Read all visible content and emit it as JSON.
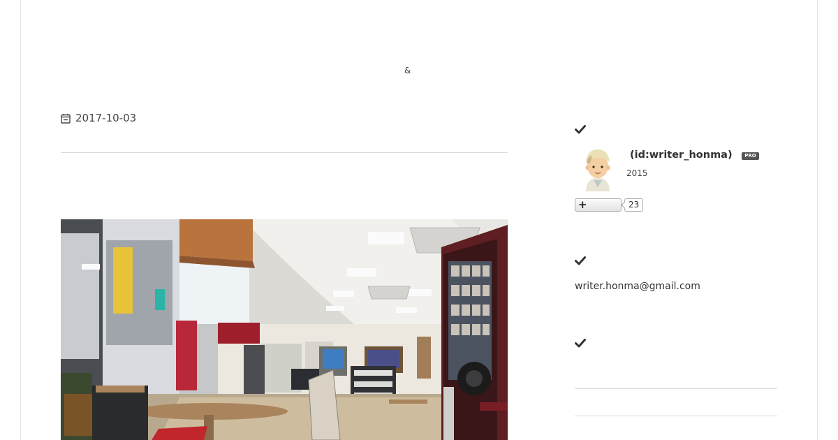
{
  "header": {
    "subtitle": "&"
  },
  "entry": {
    "date": "2017-10-03"
  },
  "sidebar": {
    "profile": {
      "name": " (id:writer_honma)",
      "badge": "PRO",
      "since": "2015",
      "follow_count": "23"
    },
    "contact": {
      "email": "writer.honma@gmail.com"
    }
  },
  "icons": {
    "date": "calendar-icon",
    "section": "checkmark-icon",
    "follow": "plus-icon"
  }
}
